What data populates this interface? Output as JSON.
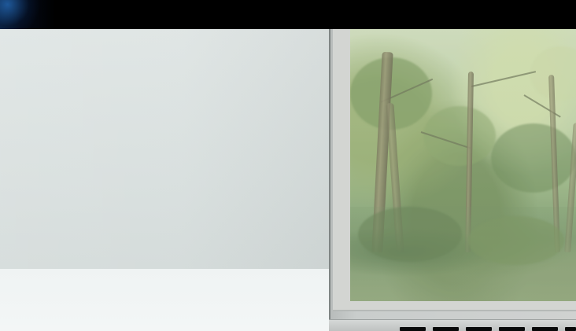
{
  "scene": {
    "subject": "laptop-with-forest-screen",
    "colors": {
      "background": "#000000",
      "wall": "#dfe5e4",
      "desk": "#f0f4f4",
      "screen_forest": "#8fac79",
      "laptop_silver": "#c9cdcc"
    }
  }
}
